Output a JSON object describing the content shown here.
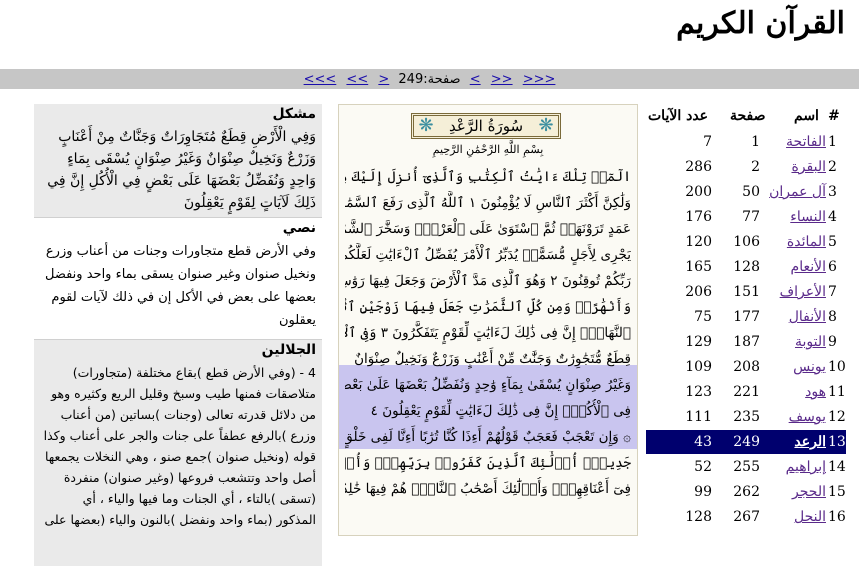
{
  "title": "القرآن الكريم",
  "nav": {
    "first": "<<<",
    "prev10": "<<",
    "prev": "<",
    "page_label": "صفحة:249",
    "next": ">",
    "next10": ">>",
    "last": ">>>"
  },
  "explanation": {
    "mushkil": {
      "heading": "مشكل",
      "text": "وَفِي الْأَرْضِ قِطَعٌ مُتَجَاوِرَاتٌ وَجَنَّاتٌ مِنْ أَعْنَابٍ وَزَرْعٌ وَنَخِيلٌ صِنْوَانٌ وَغَيْرُ صِنْوَانٍ يُسْقَى بِمَاءٍ وَاحِدٍ وَنُفَضِّلُ بَعْضَهَا عَلَى بَعْضٍ فِي الْأُكُلِ إِنَّ فِي ذَلِكَ لَآيَاتٍ لِقَوْمٍ يَعْقِلُونَ"
    },
    "nassi": {
      "heading": "نصي",
      "text": "وفي الأرض قطع متجاورات وجنات من أعناب وزرع ونخيل صنوان وغير صنوان يسقى بماء واحد ونفضل بعضها على بعض في الأكل إن في ذلك لآيات لقوم يعقلون"
    },
    "jalalayn": {
      "heading": "الجلالين",
      "text": "4 - (وفي الأرض قطع )بقاع مختلفة (متجاورات) متلاصقات فمنها طيب وسبخ وقليل الريع وكثيره وهو من دلائل قدرته تعالى (وجنات )بساتين (من أعناب وزرع )بالرفع عطفاً على جنات والجر على أعناب وكذا قوله (ونخيل صنوان )جمع صنو ، وهي النخلات يجمعها أصل واحد وتتشعب فروعها (وغير صنوان) منفردة (تسقى )بالتاء ، أي الجنات وما فيها والياء ، أي المذكور (بماء واحد ونفضل )بالنون والياء (بعضها على"
    }
  },
  "mushaf": {
    "surah_title": "سُورَةُ الرَّعْدِ",
    "basmala": "بِسْمِ اللَّهِ الرَّحْمَٰنِ الرَّحِيمِ",
    "lines": [
      "الٓمٓرۚ تِلْكَ ءَايَٰتُ ٱلْكِتَٰبِ وَٱلَّذِىٓ أُنزِلَ إِلَيْكَ مِن رَّبِّكَ ٱلْحَقُّ",
      "وَلَٰكِنَّ أَكْثَرَ ٱلنَّاسِ لَا يُؤْمِنُونَ ١ ٱللَّهُ ٱلَّذِى رَفَعَ ٱلسَّمَٰوَٰتِ بِغَيْرِ",
      "عَمَدٍ تَرَوْنَهَاۖ ثُمَّ ٱسْتَوَىٰ عَلَى ٱلْعَرْشِۖ وَسَخَّرَ ٱلشَّمْسَ وَٱلْقَمَرَۖ كُلٌّ",
      "يَجْرِى لِأَجَلٍ مُّسَمًّىۚ يُدَبِّرُ ٱلْأَمْرَ يُفَصِّلُ ٱلْءَايَٰتِ لَعَلَّكُم بِلِقَآءِ",
      "رَبِّكُمْ تُوقِنُونَ ٢ وَهُوَ ٱلَّذِى مَدَّ ٱلْأَرْضَ وَجَعَلَ فِيهَا رَوَٰسِىَ",
      "وَأَنْهَٰرًاۖ وَمِن كُلِّ ٱلثَّمَرَٰتِ جَعَلَ فِيهَا زَوْجَيْنِ ٱثْنَيْنِۖ يُغْشِى ٱلَّيْلَ",
      "ٱلنَّهَارَۚ إِنَّ فِى ذَٰلِكَ لَءَايَٰتٍ لِّقَوْمٍ يَتَفَكَّرُونَ ٣ وَفِى ٱلْأَرْضِ",
      "قِطَعٌ مُّتَجَٰوِرَٰتٌ وَجَنَّٰتٌ مِّنْ أَعْنَٰبٍ وَزَرْعٌ وَنَخِيلٌ صِنْوَانٌ",
      "وَغَيْرُ صِنْوَانٍ يُسْقَىٰ بِمَآءٍ وَٰحِدٍ وَنُفَضِّلُ بَعْضَهَا عَلَىٰ بَعْضٍ",
      "فِى ٱلْأُكُلِۚ إِنَّ فِى ذَٰلِكَ لَءَايَٰتٍ لِّقَوْمٍ يَعْقِلُونَ ٤",
      "۞ وَإِن تَعْجَبْ فَعَجَبٌ قَوْلُهُمْ أَءِذَا كُنَّا تُرَٰبًا أَءِنَّا لَفِى خَلْقٍ",
      "جَدِيدٍۗ أُو۟لَٰٓئِكَ ٱلَّذِينَ كَفَرُوا۟ بِرَبِّهِمْۖ وَأُو۟لَٰٓئِكَ ٱلْأَغْلَٰلُ",
      "فِىٓ أَعْنَاقِهِمْۖ وَأُو۟لَٰٓئِكَ أَصْحَٰبُ ٱلنَّارِۖ هُمْ فِيهَا خَٰلِدُونَ ٥"
    ]
  },
  "table": {
    "headers": {
      "num": "#",
      "name": "اسم",
      "page": "صفحة",
      "ayat": "عدد الآيات"
    },
    "rows": [
      {
        "num": "1",
        "name": "الفاتحة",
        "page": "1",
        "ayat": "7"
      },
      {
        "num": "2",
        "name": "البقرة",
        "page": "2",
        "ayat": "286"
      },
      {
        "num": "3",
        "name": "آل عمران",
        "page": "50",
        "ayat": "200"
      },
      {
        "num": "4",
        "name": "النساء",
        "page": "77",
        "ayat": "176"
      },
      {
        "num": "5",
        "name": "المائدة",
        "page": "106",
        "ayat": "120"
      },
      {
        "num": "6",
        "name": "الأنعام",
        "page": "128",
        "ayat": "165"
      },
      {
        "num": "7",
        "name": "الأعراف",
        "page": "151",
        "ayat": "206"
      },
      {
        "num": "8",
        "name": "الأنفال",
        "page": "177",
        "ayat": "75"
      },
      {
        "num": "9",
        "name": "التوبة",
        "page": "187",
        "ayat": "129"
      },
      {
        "num": "10",
        "name": "يونس",
        "page": "208",
        "ayat": "109"
      },
      {
        "num": "11",
        "name": "هود",
        "page": "221",
        "ayat": "123"
      },
      {
        "num": "12",
        "name": "يوسف",
        "page": "235",
        "ayat": "111"
      },
      {
        "num": "13",
        "name": "الرعد",
        "page": "249",
        "ayat": "43"
      },
      {
        "num": "14",
        "name": "إبراهيم",
        "page": "255",
        "ayat": "52"
      },
      {
        "num": "15",
        "name": "الحجر",
        "page": "262",
        "ayat": "99"
      },
      {
        "num": "16",
        "name": "النحل",
        "page": "267",
        "ayat": "128"
      }
    ],
    "selected_index": 12
  },
  "colors": {
    "nav_bar": "#c6c6c6",
    "selected_row": "#00006e",
    "highlight": "#c9c5ef",
    "link": "#5a2a8a"
  }
}
